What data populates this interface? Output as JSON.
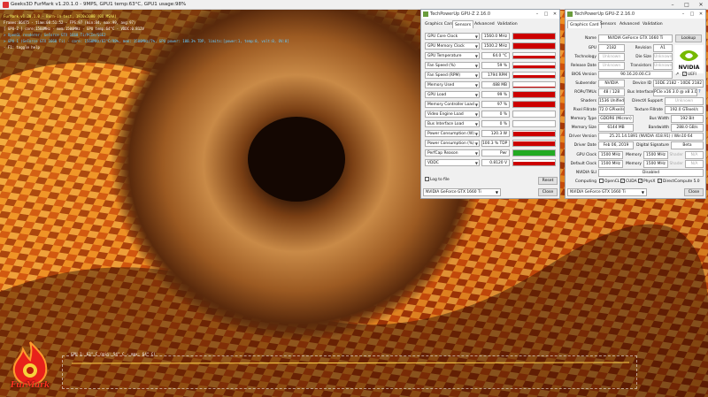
{
  "furmark": {
    "title": "Geeks3D FurMark v1.20.1.0 - 9MPS, GPU1 temp:63°C, GPU1 usage:98%",
    "osd": [
      "FurMark v1.20.1.0 - Burn-in test, 1920x1080 (0X MSAA)",
      "Frames:86475 - time:08:51:52 - FPS:97 (min:84, max:99, avg:97)",
      "[ GPU-Z ] core:1560MHz - mem:1500MHz - GPU temp:64°C - VDDC:0.812V",
      "> OpenGL renderer: GeForce GTX 1660 Ti/PCIe/SSE2",
      "> GPU 1 (GeForce GTX 1660 Ti) - core: 1560MHz/63°C/98%, mem: 1500MHz/7%, GPU power: 100.3% TDP, limits:[power:1, temp:0, volt:0, OV:0]",
      "- F1: toggle help"
    ],
    "gpu_graph_label": "GPU 1: 63° C (min: 54° C - max: 64° C)",
    "logo_text": "FurMark"
  },
  "sensors_window": {
    "title": "TechPowerUp GPU-Z 2.16.0",
    "tabs": [
      "Graphics Card",
      "Sensors",
      "Advanced",
      "Validation"
    ],
    "active_tab": 1,
    "rows": [
      {
        "label": "GPU Core Clock",
        "value": "1560.0 MHz",
        "fill": 0.95,
        "color": "#cc0000"
      },
      {
        "label": "GPU Memory Clock",
        "value": "1500.2 MHz",
        "fill": 0.95,
        "color": "#cc0000"
      },
      {
        "label": "GPU Temperature",
        "value": "64.0 °C",
        "fill": 0.55,
        "color": "#cc0000"
      },
      {
        "label": "Fan Speed (%)",
        "value": "59 %",
        "fill": 0.55,
        "color": "#cc0000"
      },
      {
        "label": "Fan Speed (RPM)",
        "value": "1794 RPM",
        "fill": 0.55,
        "color": "#cc0000"
      },
      {
        "label": "Memory Used",
        "value": "488 MB",
        "fill": 0.12,
        "color": "#cc0000"
      },
      {
        "label": "GPU Load",
        "value": "99 %",
        "fill": 0.98,
        "color": "#cc0000"
      },
      {
        "label": "Memory Controller Load",
        "value": "97 %",
        "fill": 0.96,
        "color": "#cc0000"
      },
      {
        "label": "Video Engine Load",
        "value": "0 %",
        "fill": 0,
        "color": "#cc0000"
      },
      {
        "label": "Bus Interface Load",
        "value": "0 %",
        "fill": 0,
        "color": "#cc0000"
      },
      {
        "label": "Power Consumption (W)",
        "value": "120.3 W",
        "fill": 0.85,
        "color": "#cc0000"
      },
      {
        "label": "Power Consumption (%)",
        "value": "100.3 % TDP",
        "fill": 0.9,
        "color": "#cc0000"
      },
      {
        "label": "PerfCap Reason",
        "value": "Pwr",
        "fill": 1,
        "color": "#22aa22"
      },
      {
        "label": "VDDC",
        "value": "0.8120 V",
        "fill": 0.75,
        "color": "#cc0000"
      }
    ],
    "log_label": "Log to file",
    "reset_label": "Reset",
    "gpu_select": "NVIDIA GeForce GTX 1660 Ti",
    "close_label": "Close"
  },
  "card_window": {
    "title": "TechPowerUp GPU-Z 2.16.0",
    "tabs": [
      "Graphics Card",
      "Sensors",
      "Advanced",
      "Validation"
    ],
    "active_tab": 0,
    "name_label": "Name",
    "name": "NVIDIA GeForce GTX 1660 Ti",
    "lookup": "Lookup",
    "gpu_label": "GPU",
    "gpu": "2182",
    "revision_label": "Revision",
    "revision": "A1",
    "technology_label": "Technology",
    "technology": "Unknown",
    "die_size_label": "Die Size",
    "die_size": "Unknown",
    "release_label": "Release Date",
    "release": "Unknown",
    "transistors_label": "Transistors",
    "transistors": "Unknown",
    "bios_label": "BIOS Version",
    "bios": "90.16.20.00.C3",
    "uefi_label": "UEFI",
    "subvendor_label": "Subvendor",
    "subvendor": "NVIDIA",
    "device_id_label": "Device ID",
    "device_id": "10DE 2182 - 10DE 2182",
    "rops_label": "ROPs/TMUs",
    "rops": "48 / 128",
    "bus_label": "Bus Interface",
    "bus": "PCIe x16 3.0 @ x8 3.0",
    "shaders_label": "Shaders",
    "shaders": "1536 Unified",
    "dx_label": "DirectX Support",
    "dx": "Unknown",
    "pixel_label": "Pixel Fillrate",
    "pixel": "72.0 GPixel/s",
    "texture_label": "Texture Fillrate",
    "texture": "192.0 GTexel/s",
    "memtype_label": "Memory Type",
    "memtype": "GDDR6 (Micron)",
    "buswidth_label": "Bus Width",
    "buswidth": "192 Bit",
    "memsize_label": "Memory Size",
    "memsize": "6144 MB",
    "bandwidth_label": "Bandwidth",
    "bandwidth": "288.0 GB/s",
    "driver_label": "Driver Version",
    "driver": "25.21.14.1891 (NVIDIA 418.91) / Win10 64",
    "driverdate_label": "Driver Date",
    "driverdate": "Feb 06, 2019",
    "signature_label": "Digital Signature",
    "signature": "Beta",
    "gpuclock_label": "GPU Clock",
    "gpuclock": "1500 MHz",
    "mem_label": "Memory",
    "mem": "1500 MHz",
    "shade_label": "Shader",
    "shade": "N/A",
    "defclock_label": "Default Clock",
    "defclock": "1500 MHz",
    "defmem": "1500 MHz",
    "defshade": "N/A",
    "sli_label": "NVIDIA SLI",
    "sli": "Disabled",
    "computing_label": "Computing",
    "computing": [
      "OpenCL",
      "CUDA",
      "PhysX",
      "DirectCompute 5.0"
    ],
    "gpu_select": "NVIDIA GeForce GTX 1660 Ti",
    "close_label": "Close",
    "logo_text": "NVIDIA"
  }
}
